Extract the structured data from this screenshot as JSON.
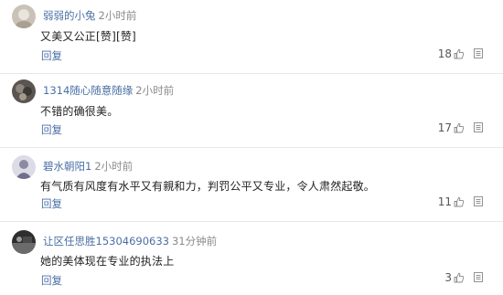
{
  "reply_label": "回复",
  "comments": [
    {
      "username": "弱弱的小兔",
      "time": "2小时前",
      "content": "又美又公正[赞][赞]",
      "likes": "18"
    },
    {
      "username": "1314随心随意随缘",
      "time": "2小时前",
      "content": "不错的确很美。",
      "likes": "17"
    },
    {
      "username": "碧水朝阳1",
      "time": "2小时前",
      "content": "有气质有风度有水平又有親和力，判罚公平又专业，令人肃然起敬。",
      "likes": "11"
    },
    {
      "username": "让区任思胜15304690633",
      "time": "31分钟前",
      "content": "她的美体现在专业的执法上",
      "likes": "3"
    }
  ],
  "colors": {
    "username": "#4a6fa5",
    "time": "#8a8a8a",
    "divider": "#e8e8e8"
  },
  "icons": [
    "avatar",
    "thumbs-up-icon",
    "more-icon"
  ]
}
